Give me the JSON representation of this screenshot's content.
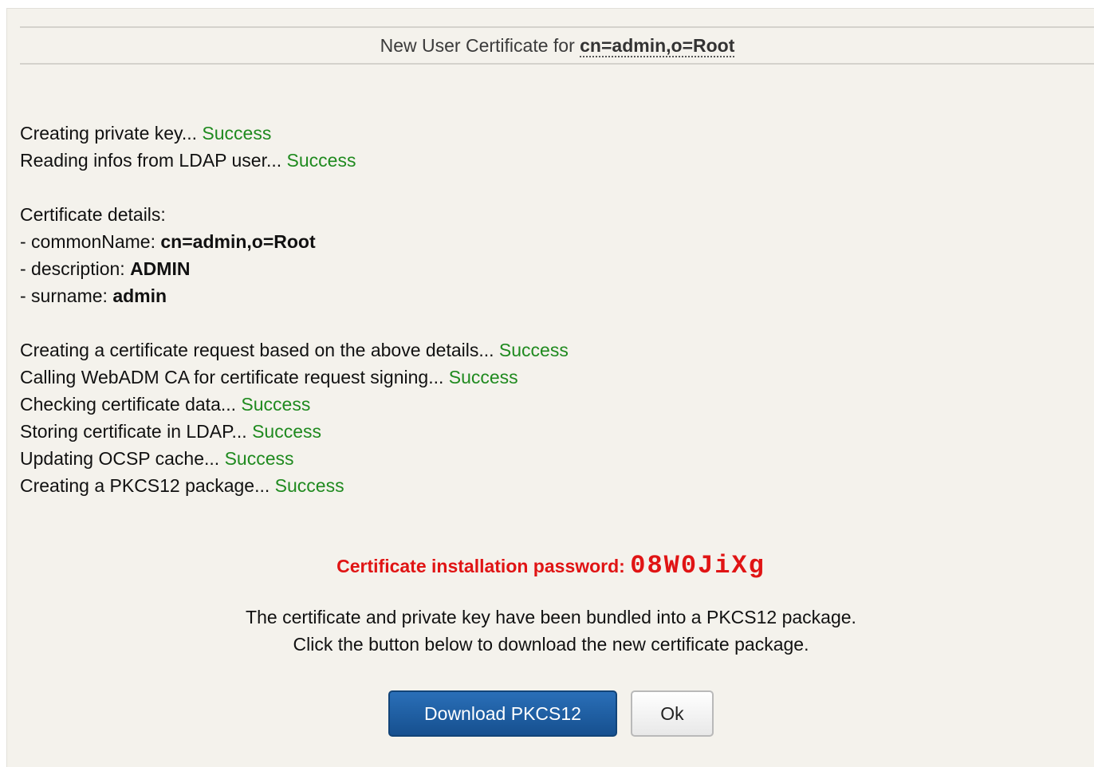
{
  "header": {
    "title_prefix": "New User Certificate for",
    "user_dn": "cn=admin,o=Root"
  },
  "log": {
    "steps_a": [
      {
        "text": "Creating private key...",
        "status": "Success"
      },
      {
        "text": "Reading infos from LDAP user...",
        "status": "Success"
      }
    ],
    "details_heading": "Certificate details:",
    "details": [
      {
        "key": "- commonName:",
        "value": "cn=admin,o=Root"
      },
      {
        "key": "- description:",
        "value": "ADMIN"
      },
      {
        "key": "- surname:",
        "value": "admin"
      }
    ],
    "steps_b": [
      {
        "text": "Creating a certificate request based on the above details...",
        "status": "Success"
      },
      {
        "text": "Calling WebADM CA for certificate request signing...",
        "status": "Success"
      },
      {
        "text": "Checking certificate data...",
        "status": "Success"
      },
      {
        "text": "Storing certificate in LDAP...",
        "status": "Success"
      },
      {
        "text": "Updating OCSP cache...",
        "status": "Success"
      },
      {
        "text": "Creating a PKCS12 package...",
        "status": "Success"
      }
    ]
  },
  "password": {
    "label": "Certificate installation password:",
    "value": "08W0JiXg"
  },
  "info": {
    "line1": "The certificate and private key have been bundled into a PKCS12 package.",
    "line2": "Click the button below to download the new certificate package."
  },
  "buttons": {
    "download_label": "Download PKCS12",
    "ok_label": "Ok"
  },
  "colors": {
    "success": "#1f8a1f",
    "password": "#e01414",
    "primary_button": "#1e5fa3",
    "background": "#f4f2ec"
  }
}
